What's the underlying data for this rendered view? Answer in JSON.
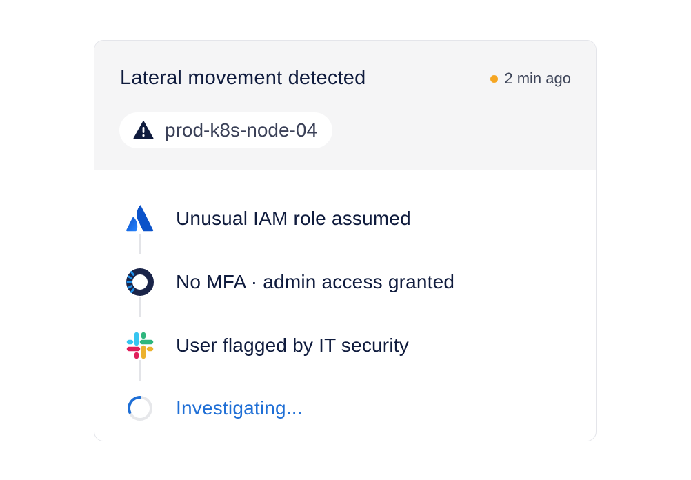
{
  "alert": {
    "title": "Lateral movement detected",
    "time_ago": "2 min ago",
    "status_color": "#f5a623",
    "host": "prod-k8s-node-04",
    "host_icon": "warning-icon"
  },
  "timeline": {
    "events": [
      {
        "label": "Unusual IAM role assumed",
        "icon": "atlassian-logo-icon",
        "state": "done"
      },
      {
        "label": "No MFA · admin access granted",
        "icon": "okta-logo-icon",
        "state": "done"
      },
      {
        "label": "User flagged by IT security",
        "icon": "slack-logo-icon",
        "state": "done"
      },
      {
        "label": "Investigating...",
        "icon": "loading-spinner-icon",
        "state": "in-progress"
      }
    ]
  },
  "colors": {
    "text_primary": "#0f1b3d",
    "active_blue": "#1f6fd6",
    "header_bg": "#f5f5f6"
  }
}
